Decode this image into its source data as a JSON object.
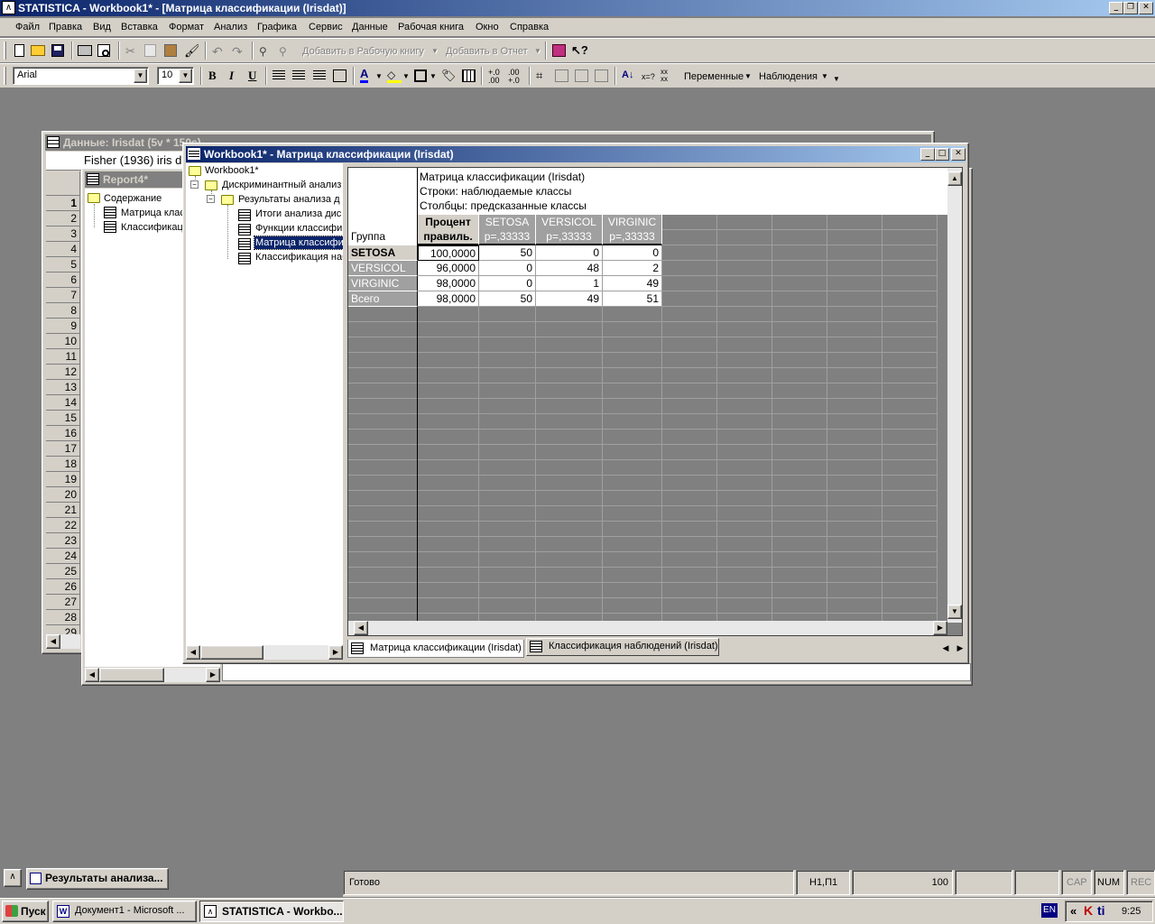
{
  "app": {
    "title": "STATISTICA - Workbook1* - [Матрица классификации (Irisdat)]"
  },
  "menu": [
    "Файл",
    "Правка",
    "Вид",
    "Вставка",
    "Формат",
    "Анализ",
    "Графика",
    "Сервис",
    "Данные",
    "Рабочая книга",
    "Окно",
    "Справка"
  ],
  "toolbar1": {
    "add_to_workbook": "Добавить в Рабочую книгу",
    "add_to_report": "Добавить в Отчет"
  },
  "toolbar2": {
    "font": "Arial",
    "size": "10",
    "bold": "B",
    "italic": "I",
    "underline": "U",
    "variables": "Переменные",
    "cases": "Наблюдения"
  },
  "data_window": {
    "title": "Данные: Irisdat (5v * 150c)",
    "description": "Fisher (1936) iris d",
    "rows": [
      "1",
      "2",
      "3",
      "4",
      "5",
      "6",
      "7",
      "8",
      "9",
      "10",
      "11",
      "12",
      "13",
      "14",
      "15",
      "16",
      "17",
      "18",
      "19",
      "20",
      "21",
      "22",
      "23",
      "24",
      "25",
      "26",
      "27",
      "28",
      "29"
    ]
  },
  "report_window": {
    "title": "Report4*",
    "tree": [
      "Содержание",
      "Матрица клас",
      "Классификаци"
    ]
  },
  "workbook": {
    "title": "Workbook1* - Матрица классификации (Irisdat)",
    "tree": {
      "root": "Workbook1*",
      "analysis": "Дискриминантный анализ",
      "results": "Результаты анализа д",
      "items": [
        "Итоги анализа дис",
        "Функции классифи",
        "Матрица классифи",
        "Классификация наб"
      ]
    },
    "table": {
      "header_lines": [
        "Матрица классификации (Irisdat)",
        "Строки: наблюдаемые классы",
        "Столбцы: предсказанные классы"
      ],
      "group_label": "Группа",
      "columns": [
        {
          "line1": "Процент",
          "line2": "правиль."
        },
        {
          "line1": "SETOSA",
          "line2": "p=,33333"
        },
        {
          "line1": "VERSICOL",
          "line2": "p=,33333"
        },
        {
          "line1": "VIRGINIC",
          "line2": "p=,33333"
        }
      ],
      "rows": [
        {
          "label": "SETOSA",
          "values": [
            "100,0000",
            "50",
            "0",
            "0"
          ]
        },
        {
          "label": "VERSICOL",
          "values": [
            "96,0000",
            "0",
            "48",
            "2"
          ]
        },
        {
          "label": "VIRGINIC",
          "values": [
            "98,0000",
            "0",
            "1",
            "49"
          ]
        },
        {
          "label": "Всего",
          "values": [
            "98,0000",
            "50",
            "49",
            "51"
          ]
        }
      ]
    },
    "tabs": [
      "Матрица классификации (Irisdat)",
      "Классификация наблюдений (Irisdat)"
    ]
  },
  "minimized": {
    "label": "Результаты анализа..."
  },
  "status": {
    "ready": "Готово",
    "cell": "Н1,П1",
    "zoom": "100",
    "cap": "CAP",
    "num": "NUM",
    "rec": "REC"
  },
  "taskbar": {
    "start": "Пуск",
    "items": [
      "Документ1 - Microsoft ...",
      "STATISTICA - Workbo..."
    ],
    "lang": "EN",
    "clock": "9:25"
  },
  "colors": {
    "titlebar_active": "#0a246a",
    "titlebar_active_end": "#a6caf0",
    "titlebar_inactive": "#808080",
    "face": "#d4d0c8",
    "workspace": "#808080"
  }
}
